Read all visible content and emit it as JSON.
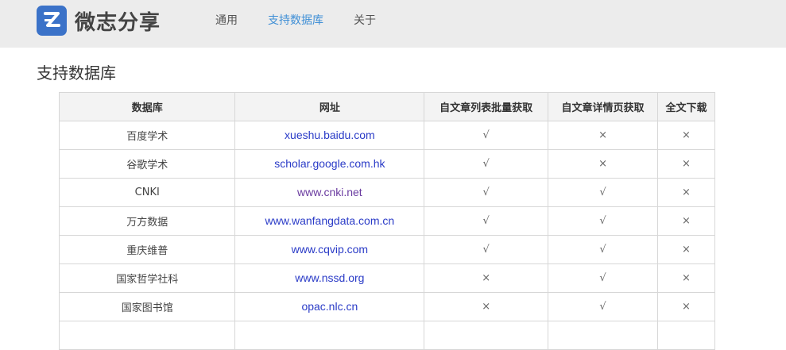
{
  "header": {
    "logo_letter": "Z",
    "brand": "微志分享",
    "brand_color": "#3b72c8",
    "nav": [
      {
        "label": "通用",
        "active": false
      },
      {
        "label": "支持数据库",
        "active": true
      },
      {
        "label": "关于",
        "active": false
      }
    ],
    "active_color": "#3f8fd6"
  },
  "main": {
    "title": "支持数据库",
    "table": {
      "headers": [
        "数据库",
        "网址",
        "自文章列表批量获取",
        "自文章详情页获取",
        "全文下载"
      ],
      "rows": [
        {
          "db": "百度学术",
          "url": "xueshu.baidu.com",
          "list": "√",
          "detail": "×",
          "download": "×"
        },
        {
          "db": "谷歌学术",
          "url": "scholar.google.com.hk",
          "list": "√",
          "detail": "×",
          "download": "×"
        },
        {
          "db": "CNKI",
          "url": "www.cnki.net",
          "list": "√",
          "detail": "√",
          "download": "×"
        },
        {
          "db": "万方数据",
          "url": "www.wanfangdata.com.cn",
          "list": "√",
          "detail": "√",
          "download": "×"
        },
        {
          "db": "重庆维普",
          "url": "www.cqvip.com",
          "list": "√",
          "detail": "√",
          "download": "×"
        },
        {
          "db": "国家哲学社科",
          "url": "www.nssd.org",
          "list": "×",
          "detail": "√",
          "download": "×"
        },
        {
          "db": "国家图书馆",
          "url": "opac.nlc.cn",
          "list": "×",
          "detail": "√",
          "download": "×"
        },
        {
          "db": "",
          "url": "",
          "list": "",
          "detail": "",
          "download": ""
        }
      ]
    }
  }
}
